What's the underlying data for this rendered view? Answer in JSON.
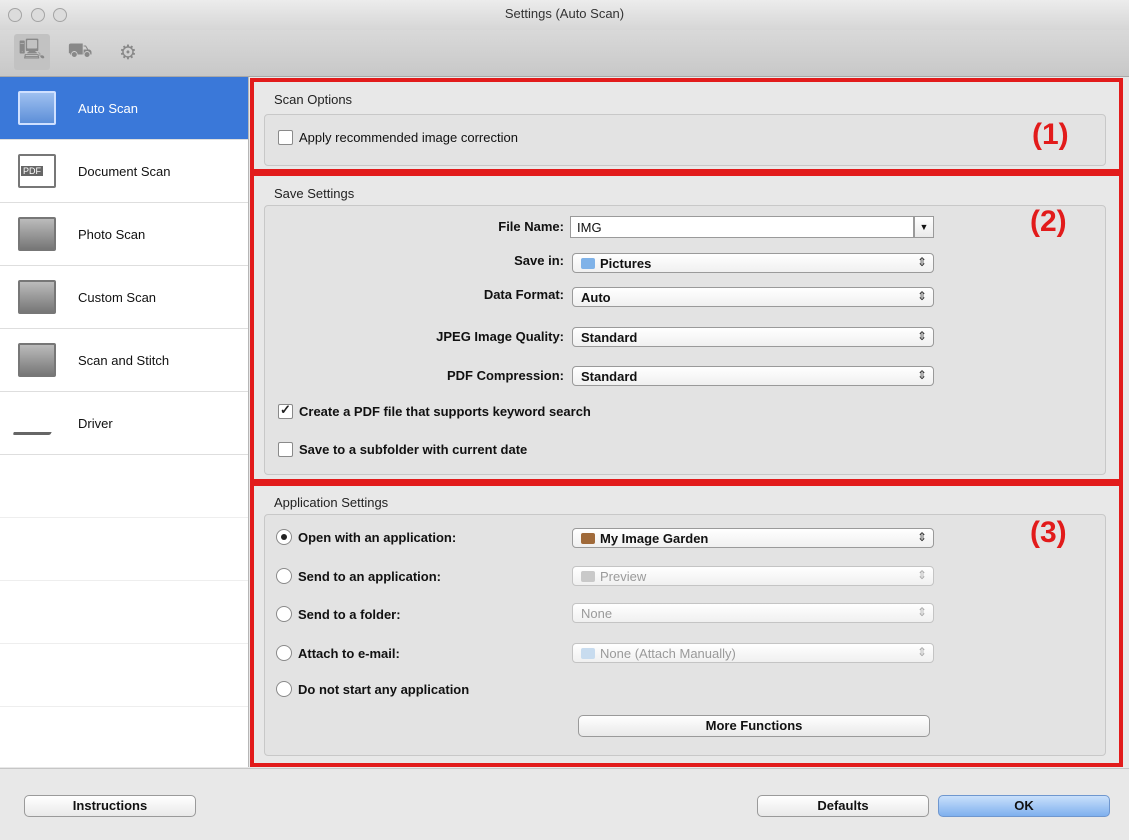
{
  "window": {
    "title": "Settings (Auto Scan)"
  },
  "toolbar": {
    "tabs": [
      {
        "icon": "scan-from-computer-icon"
      },
      {
        "icon": "scan-from-panel-icon"
      },
      {
        "icon": "general-settings-icon"
      }
    ]
  },
  "sidebar": {
    "items": [
      {
        "label": "Auto Scan",
        "icon": "auto-scan-icon",
        "selected": true
      },
      {
        "label": "Document Scan",
        "icon": "document-scan-icon"
      },
      {
        "label": "Photo Scan",
        "icon": "photo-scan-icon"
      },
      {
        "label": "Custom Scan",
        "icon": "custom-scan-icon"
      },
      {
        "label": "Scan and Stitch",
        "icon": "scan-and-stitch-icon"
      },
      {
        "label": "Driver",
        "icon": "driver-icon"
      }
    ]
  },
  "scan_options": {
    "title": "Scan Options",
    "apply_correction": {
      "label": "Apply recommended image correction",
      "checked": false
    },
    "marker": "(1)"
  },
  "save_settings": {
    "title": "Save Settings",
    "marker": "(2)",
    "file_name": {
      "label": "File Name:",
      "value": "IMG"
    },
    "save_in": {
      "label": "Save in:",
      "value": "Pictures"
    },
    "data_format": {
      "label": "Data Format:",
      "value": "Auto"
    },
    "jpeg_quality": {
      "label": "JPEG Image Quality:",
      "value": "Standard"
    },
    "pdf_compression": {
      "label": "PDF Compression:",
      "value": "Standard"
    },
    "keyword_pdf": {
      "label": "Create a PDF file that supports keyword search",
      "checked": true
    },
    "subfolder": {
      "label": "Save to a subfolder with current date",
      "checked": false
    }
  },
  "app_settings": {
    "title": "Application Settings",
    "marker": "(3)",
    "open_with": {
      "label": "Open with an application:",
      "value": "My Image Garden",
      "selected": true
    },
    "send_to_app": {
      "label": "Send to an application:",
      "value": "Preview"
    },
    "send_to_folder": {
      "label": "Send to a folder:",
      "value": "None"
    },
    "attach_email": {
      "label": "Attach to e-mail:",
      "value": "None (Attach Manually)"
    },
    "no_app": {
      "label": "Do not start any application"
    },
    "more_functions": "More Functions"
  },
  "footer": {
    "instructions": "Instructions",
    "defaults": "Defaults",
    "ok": "OK"
  },
  "colors": {
    "highlight": "#e21b1b",
    "selection": "#3a78d9"
  }
}
